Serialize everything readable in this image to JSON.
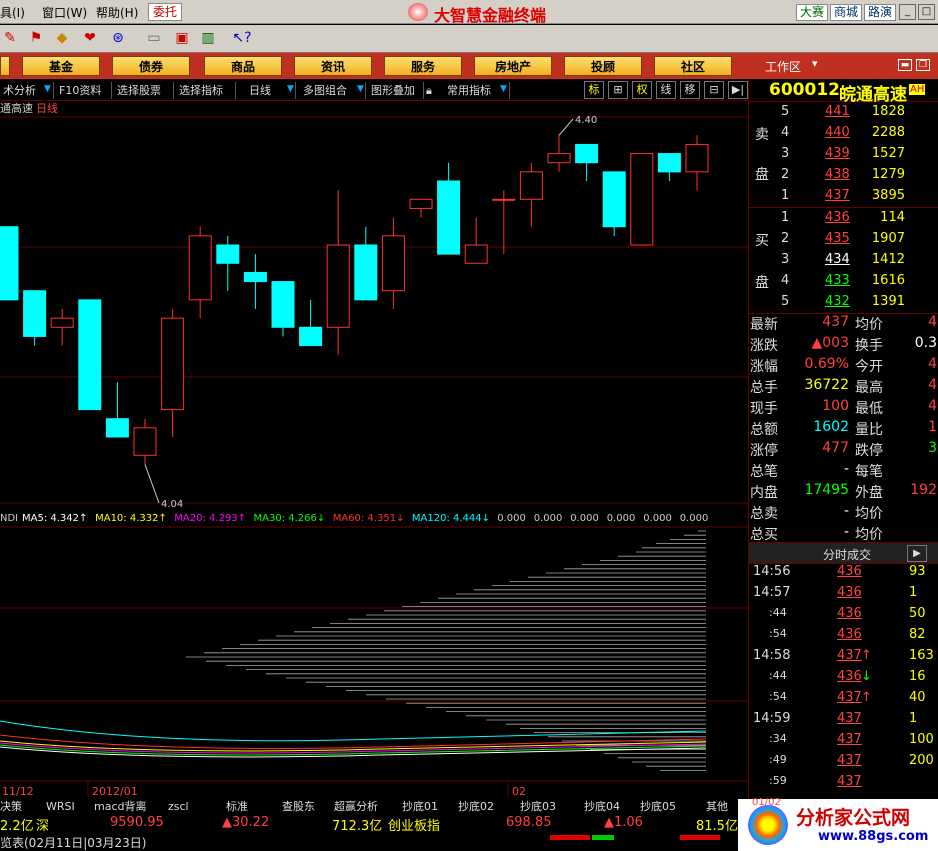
{
  "menubar": {
    "items": [
      "具(I)",
      "窗口(W)",
      "帮助(H)"
    ],
    "weituo": "委托",
    "title": "大智慧金融终端",
    "right_buttons": [
      "大赛",
      "商城",
      "路演"
    ]
  },
  "navbar": {
    "items": [
      "基金",
      "债券",
      "商品",
      "资讯",
      "服务",
      "房地产",
      "投顾",
      "社区"
    ],
    "workspace": "工作区"
  },
  "ctrlbar": {
    "items": [
      "术分析",
      "F10资料",
      "选择股票",
      "选择指标",
      "日线",
      "多图组合",
      "图形叠加",
      "常用指标"
    ],
    "toggles": [
      "标",
      "⊞",
      "权",
      "线",
      "移"
    ]
  },
  "chart": {
    "subtitle_name": "通高速",
    "subtitle_period": "日线",
    "ma_label": "NDI",
    "ma_items": [
      {
        "text": "MA5: 4.342↑",
        "color": "#ffffff"
      },
      {
        "text": "MA10: 4.332↑",
        "color": "#ffff00"
      },
      {
        "text": "MA20: 4.293↑",
        "color": "#ff00ff"
      },
      {
        "text": "MA30: 4.266↓",
        "color": "#00ff00"
      },
      {
        "text": "MA60: 4.351↓",
        "color": "#ff3030"
      },
      {
        "text": "MA120: 4.444↓",
        "color": "#00ffff"
      },
      {
        "text": "0.000",
        "color": "#cccccc"
      },
      {
        "text": "0.000",
        "color": "#cccccc"
      },
      {
        "text": "0.000",
        "color": "#cccccc"
      },
      {
        "text": "0.000",
        "color": "#cccccc"
      },
      {
        "text": "0.000",
        "color": "#cccccc"
      },
      {
        "text": "0.000",
        "color": "#cccccc"
      }
    ],
    "high_label": "4.40",
    "low_label": "4.04",
    "x_labels": [
      "11/12",
      "2012/01",
      "02"
    ],
    "up_color": "#ff3030",
    "down_color": "#00ffff"
  },
  "chart_data": {
    "type": "candlestick",
    "ylim": [
      4.0,
      4.42
    ],
    "candles": [
      {
        "o": 4.3,
        "h": 4.3,
        "l": 4.22,
        "c": 4.22
      },
      {
        "o": 4.23,
        "h": 4.23,
        "l": 4.17,
        "c": 4.18
      },
      {
        "o": 4.19,
        "h": 4.21,
        "l": 4.17,
        "c": 4.2
      },
      {
        "o": 4.22,
        "h": 4.22,
        "l": 4.1,
        "c": 4.1
      },
      {
        "o": 4.09,
        "h": 4.13,
        "l": 4.07,
        "c": 4.07
      },
      {
        "o": 4.05,
        "h": 4.09,
        "l": 4.04,
        "c": 4.08
      },
      {
        "o": 4.1,
        "h": 4.21,
        "l": 4.07,
        "c": 4.2
      },
      {
        "o": 4.22,
        "h": 4.3,
        "l": 4.2,
        "c": 4.29
      },
      {
        "o": 4.28,
        "h": 4.29,
        "l": 4.23,
        "c": 4.26
      },
      {
        "o": 4.25,
        "h": 4.27,
        "l": 4.21,
        "c": 4.24
      },
      {
        "o": 4.24,
        "h": 4.24,
        "l": 4.18,
        "c": 4.19
      },
      {
        "o": 4.19,
        "h": 4.22,
        "l": 4.17,
        "c": 4.17
      },
      {
        "o": 4.19,
        "h": 4.34,
        "l": 4.16,
        "c": 4.28
      },
      {
        "o": 4.28,
        "h": 4.3,
        "l": 4.22,
        "c": 4.22
      },
      {
        "o": 4.23,
        "h": 4.31,
        "l": 4.21,
        "c": 4.29
      },
      {
        "o": 4.32,
        "h": 4.33,
        "l": 4.31,
        "c": 4.33
      },
      {
        "o": 4.35,
        "h": 4.37,
        "l": 4.27,
        "c": 4.27
      },
      {
        "o": 4.26,
        "h": 4.31,
        "l": 4.26,
        "c": 4.28
      },
      {
        "o": 4.33,
        "h": 4.34,
        "l": 4.27,
        "c": 4.33
      },
      {
        "o": 4.33,
        "h": 4.37,
        "l": 4.3,
        "c": 4.36
      },
      {
        "o": 4.37,
        "h": 4.4,
        "l": 4.36,
        "c": 4.38
      },
      {
        "o": 4.39,
        "h": 4.39,
        "l": 4.35,
        "c": 4.37
      },
      {
        "o": 4.36,
        "h": 4.36,
        "l": 4.29,
        "c": 4.3
      },
      {
        "o": 4.28,
        "h": 4.38,
        "l": 4.28,
        "c": 4.38
      },
      {
        "o": 4.38,
        "h": 4.38,
        "l": 4.35,
        "c": 4.36
      },
      {
        "o": 4.36,
        "h": 4.4,
        "l": 4.34,
        "c": 4.39
      }
    ]
  },
  "bottomtabs": [
    "决策",
    "WRSI",
    "macd背离",
    "zscl",
    "标准",
    "查股东",
    "超赢分析",
    "抄底01",
    "抄底02",
    "抄底03",
    "抄底04",
    "抄底05",
    "其他"
  ],
  "indexbar": {
    "a": "2.2亿",
    "b": "深",
    "c": "9590.95",
    "d": "▲30.22",
    "e": "712.3亿",
    "f": "创业板指",
    "g": "698.85",
    "h": "▲1.06",
    "i": "81.5亿"
  },
  "statusbar": {
    "text": "览表(02月11日|03月23日)"
  },
  "stock": {
    "code": "600012",
    "name": "皖通高速",
    "badge": "AH"
  },
  "orderbook": {
    "sell_label": [
      "卖",
      "盘"
    ],
    "buy_label": [
      "买",
      "盘"
    ],
    "sell": [
      {
        "lvl": "5",
        "px": "441",
        "vol": "1828"
      },
      {
        "lvl": "4",
        "px": "440",
        "vol": "2288"
      },
      {
        "lvl": "3",
        "px": "439",
        "vol": "1527"
      },
      {
        "lvl": "2",
        "px": "438",
        "vol": "1279"
      },
      {
        "lvl": "1",
        "px": "437",
        "vol": "3895"
      }
    ],
    "buy": [
      {
        "lvl": "1",
        "px": "436",
        "vol": "114"
      },
      {
        "lvl": "2",
        "px": "435",
        "vol": "1907"
      },
      {
        "lvl": "3",
        "px": "434",
        "vol": "1412"
      },
      {
        "lvl": "4",
        "px": "433",
        "vol": "1616"
      },
      {
        "lvl": "5",
        "px": "432",
        "vol": "1391"
      }
    ]
  },
  "quote": [
    {
      "l": "最新",
      "v": "437",
      "vc": "#ff4040",
      "l2": "均价",
      "v2": "4",
      "v2c": "#ff4040"
    },
    {
      "l": "涨跌",
      "v": "▲003",
      "vc": "#ff4040",
      "l2": "换手",
      "v2": "0.3",
      "v2c": "#ffffff"
    },
    {
      "l": "涨幅",
      "v": "0.69%",
      "vc": "#ff4040",
      "l2": "今开",
      "v2": "4",
      "v2c": "#ff4040"
    },
    {
      "l": "总手",
      "v": "36722",
      "vc": "#ffff00",
      "l2": "最高",
      "v2": "4",
      "v2c": "#ff4040"
    },
    {
      "l": "现手",
      "v": "100",
      "vc": "#ff4040",
      "l2": "最低",
      "v2": "4",
      "v2c": "#ff4040"
    },
    {
      "l": "总额",
      "v": "1602",
      "vc": "#00ffff",
      "l2": "量比",
      "v2": "1",
      "v2c": "#ff4040"
    },
    {
      "l": "涨停",
      "v": "477",
      "vc": "#ff4040",
      "l2": "跌停",
      "v2": "3",
      "v2c": "#00ff00"
    },
    {
      "l": "总笔",
      "v": "-",
      "vc": "#ffffff",
      "l2": "每笔",
      "v2": "",
      "v2c": "#ffffff"
    },
    {
      "l": "内盘",
      "v": "17495",
      "vc": "#00ff00",
      "l2": "外盘",
      "v2": "192",
      "v2c": "#ff4040"
    },
    {
      "l": "总卖",
      "v": "-",
      "vc": "#ffffff",
      "l2": "均价",
      "v2": "",
      "v2c": "#ffffff"
    },
    {
      "l": "总买",
      "v": "-",
      "vc": "#ffffff",
      "l2": "均价",
      "v2": "",
      "v2c": "#ffffff"
    }
  ],
  "ticks_header": "分时成交",
  "ticks": [
    {
      "t": "14:56",
      "p": "436",
      "arrow": "",
      "v": "93"
    },
    {
      "t": "14:57",
      "p": "436",
      "arrow": "",
      "v": "1"
    },
    {
      "t": ":44",
      "p": "436",
      "arrow": "",
      "v": "50"
    },
    {
      "t": ":54",
      "p": "436",
      "arrow": "",
      "v": "82"
    },
    {
      "t": "14:58",
      "p": "437",
      "arrow": "↑",
      "v": "163"
    },
    {
      "t": ":44",
      "p": "436",
      "arrow": "↓",
      "v": "16"
    },
    {
      "t": ":54",
      "p": "437",
      "arrow": "↑",
      "v": "40"
    },
    {
      "t": "14:59",
      "p": "437",
      "arrow": "",
      "v": "1"
    },
    {
      "t": ":34",
      "p": "437",
      "arrow": "",
      "v": "100"
    },
    {
      "t": ":49",
      "p": "437",
      "arrow": "",
      "v": "200"
    },
    {
      "t": ":59",
      "p": "437",
      "arrow": "",
      "v": ""
    }
  ],
  "logo": {
    "main": "分析家公式网",
    "sub": "www.88gs.com",
    "tag": "01/02"
  }
}
